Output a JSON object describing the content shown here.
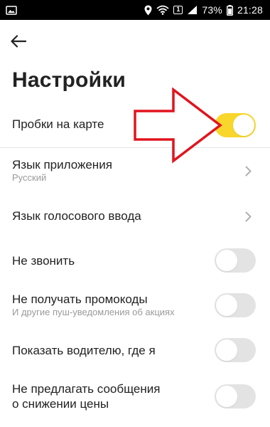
{
  "status_bar": {
    "battery_percent": "73%",
    "time": "21:28",
    "notification_badge": "1"
  },
  "header": {
    "title": "Настройки"
  },
  "settings": {
    "traffic": {
      "label": "Пробки на карте",
      "enabled": true
    },
    "app_language": {
      "label": "Язык приложения",
      "value": "Русский"
    },
    "voice_language": {
      "label": "Язык голосового ввода"
    },
    "do_not_call": {
      "label": "Не звонить",
      "enabled": false
    },
    "no_promocodes": {
      "label": "Не получать промокоды",
      "description": "И другие пуш-уведомления об акциях",
      "enabled": false
    },
    "show_driver": {
      "label": "Показать водителю, где я",
      "enabled": false
    },
    "no_price_drop": {
      "label_line1": "Не предлагать сообщения",
      "label_line2": "о снижении цены",
      "enabled": false
    }
  },
  "colors": {
    "toggle_on": "#f8d62b",
    "toggle_off": "#e3e3e3",
    "annotation_arrow": "#e0141e"
  },
  "icons": {
    "back": "arrow-left-icon",
    "chevron": "chevron-right-icon"
  }
}
